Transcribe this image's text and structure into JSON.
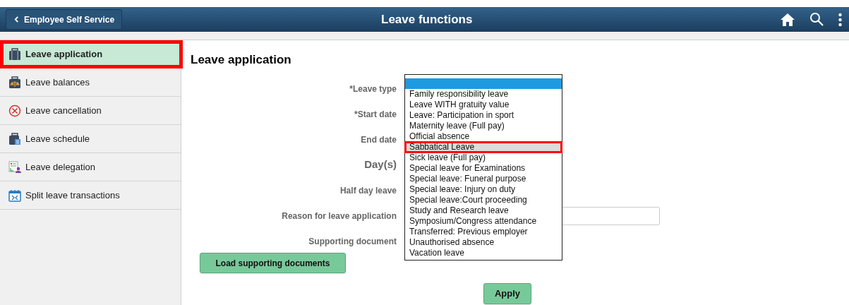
{
  "header": {
    "back_button": "Employee Self Service",
    "title": "Leave functions"
  },
  "sidebar": {
    "items": [
      {
        "label": "Leave application",
        "selected": true,
        "highlighted": true
      },
      {
        "label": "Leave balances",
        "selected": false,
        "highlighted": false
      },
      {
        "label": "Leave cancellation",
        "selected": false,
        "highlighted": false
      },
      {
        "label": "Leave schedule",
        "selected": false,
        "highlighted": false
      },
      {
        "label": "Leave delegation",
        "selected": false,
        "highlighted": false
      },
      {
        "label": "Split leave transactions",
        "selected": false,
        "highlighted": false
      }
    ]
  },
  "page_title": "Leave application",
  "form": {
    "fields": [
      {
        "label": "*Leave type",
        "large": false
      },
      {
        "label": "*Start date",
        "large": false
      },
      {
        "label": "End date",
        "large": false
      },
      {
        "label": "Day(s)",
        "large": true
      },
      {
        "label": "Half day leave",
        "large": false
      },
      {
        "label": "Reason for leave application",
        "large": false,
        "has_input": true
      },
      {
        "label": "Supporting document",
        "large": false
      }
    ],
    "load_button": "Load supporting documents",
    "apply_button": "Apply"
  },
  "dropdown": {
    "blank_option_selected": true,
    "options": [
      {
        "label": "Family responsibility leave",
        "hovered": false,
        "highlighted": false
      },
      {
        "label": "Leave WITH gratuity value",
        "hovered": false,
        "highlighted": false
      },
      {
        "label": "Leave: Participation in sport",
        "hovered": false,
        "highlighted": false
      },
      {
        "label": "Maternity leave (Full pay)",
        "hovered": false,
        "highlighted": false
      },
      {
        "label": "Official absence",
        "hovered": false,
        "highlighted": false
      },
      {
        "label": "Sabbatical Leave",
        "hovered": true,
        "highlighted": true
      },
      {
        "label": "Sick leave (Full pay)",
        "hovered": false,
        "highlighted": false
      },
      {
        "label": "Special leave for Examinations",
        "hovered": false,
        "highlighted": false
      },
      {
        "label": "Special leave: Funeral purpose",
        "hovered": false,
        "highlighted": false
      },
      {
        "label": "Special leave: Injury on duty",
        "hovered": false,
        "highlighted": false
      },
      {
        "label": "Special leave:Court proceeding",
        "hovered": false,
        "highlighted": false
      },
      {
        "label": "Study and Research leave",
        "hovered": false,
        "highlighted": false
      },
      {
        "label": "Symposium/Congress attendance",
        "hovered": false,
        "highlighted": false
      },
      {
        "label": "Transferred: Previous employer",
        "hovered": false,
        "highlighted": false
      },
      {
        "label": "Unauthorised absence",
        "hovered": false,
        "highlighted": false
      },
      {
        "label": "Vacation leave",
        "hovered": false,
        "highlighted": false
      }
    ]
  }
}
